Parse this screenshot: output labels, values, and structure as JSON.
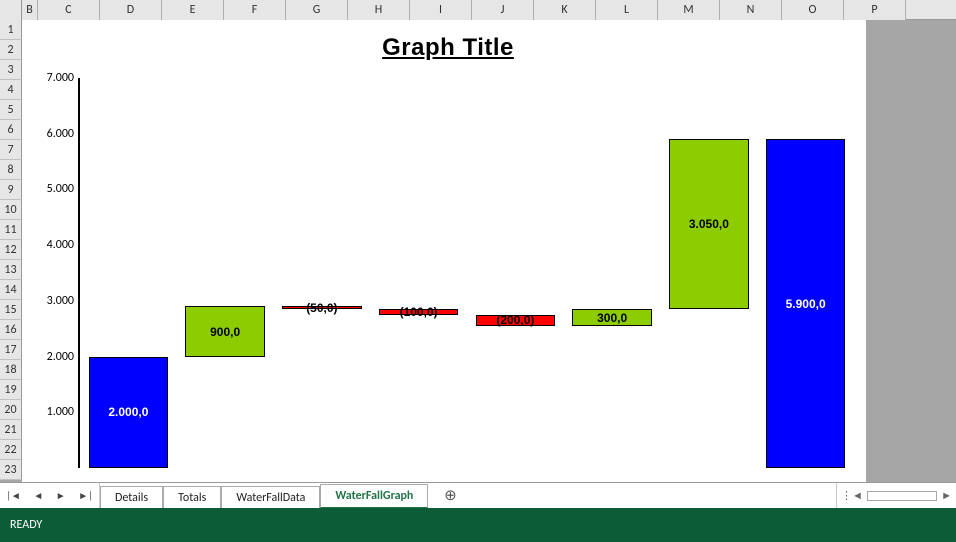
{
  "columns": [
    "B",
    "C",
    "D",
    "E",
    "F",
    "G",
    "H",
    "I",
    "J",
    "K",
    "L",
    "M",
    "N",
    "O",
    "P"
  ],
  "rows": [
    "1",
    "2",
    "3",
    "4",
    "5",
    "6",
    "7",
    "8",
    "9",
    "10",
    "11",
    "12",
    "13",
    "14",
    "15",
    "16",
    "17",
    "18",
    "19",
    "20",
    "21",
    "22",
    "23"
  ],
  "tabs": {
    "items": [
      "Details",
      "Totals",
      "WaterFallData",
      "WaterFallGraph"
    ],
    "active": "WaterFallGraph"
  },
  "status": {
    "ready": "READY"
  },
  "icons": {
    "first": "|◄",
    "prev": "◄",
    "next": "►",
    "last": "►|",
    "plus": "⊕",
    "dots": "⋮",
    "left": "◄",
    "right": "►"
  },
  "chart_data": {
    "type": "waterfall",
    "title": "Graph Title",
    "ylim": [
      0,
      7000
    ],
    "yticks": [
      0,
      1000,
      2000,
      3000,
      4000,
      5000,
      6000,
      7000
    ],
    "ytick_labels": [
      "",
      "1.000",
      "2.000",
      "3.000",
      "4.000",
      "5.000",
      "6.000",
      "7.000"
    ],
    "bars": [
      {
        "kind": "total",
        "start": 0,
        "end": 2000,
        "value": 2000,
        "label": "2.000,0",
        "label_color": "white",
        "label_pos": "center",
        "color": "blue"
      },
      {
        "kind": "increase",
        "start": 2000,
        "end": 2900,
        "value": 900,
        "label": "900,0",
        "label_color": "black",
        "label_pos": "center",
        "color": "green"
      },
      {
        "kind": "decrease",
        "start": 2850,
        "end": 2900,
        "value": -50,
        "label": "(50,0)",
        "label_color": "black",
        "label_pos": "overlay",
        "color": "red"
      },
      {
        "kind": "decrease",
        "start": 2750,
        "end": 2850,
        "value": -100,
        "label": "(100,0)",
        "label_color": "black",
        "label_pos": "overlay",
        "color": "red"
      },
      {
        "kind": "decrease",
        "start": 2550,
        "end": 2750,
        "value": -200,
        "label": "(200,0)",
        "label_color": "black",
        "label_pos": "overlay",
        "color": "red"
      },
      {
        "kind": "increase",
        "start": 2550,
        "end": 2850,
        "value": 300,
        "label": "300,0",
        "label_color": "black",
        "label_pos": "center",
        "color": "green"
      },
      {
        "kind": "increase",
        "start": 2850,
        "end": 5900,
        "value": 3050,
        "label": "3.050,0",
        "label_color": "black",
        "label_pos": "center",
        "color": "green"
      },
      {
        "kind": "total",
        "start": 0,
        "end": 5900,
        "value": 5900,
        "label": "5.900,0",
        "label_color": "white",
        "label_pos": "center",
        "color": "blue"
      }
    ]
  }
}
